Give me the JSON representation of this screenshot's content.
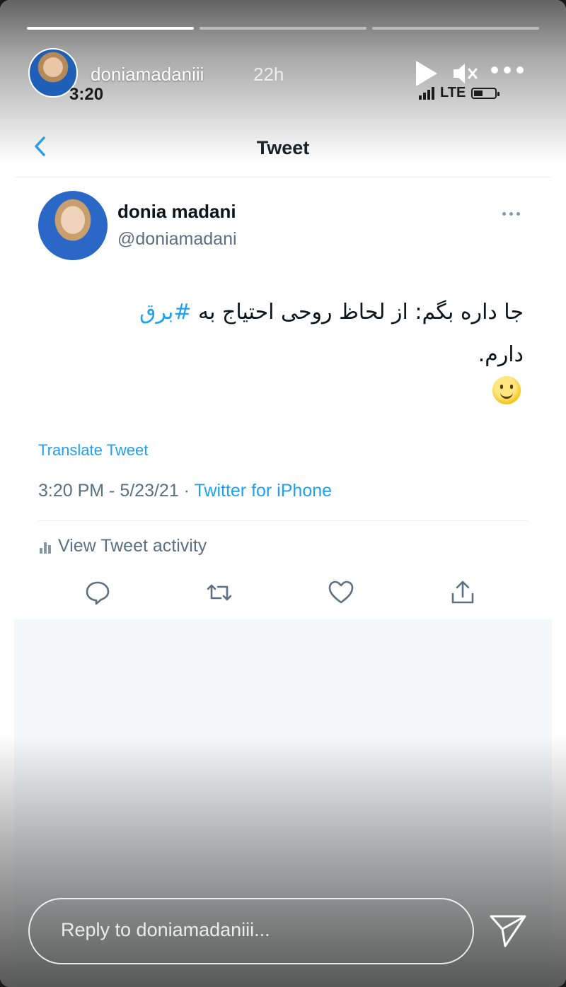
{
  "story": {
    "username": "doniamadaniii",
    "time_ago": "22h",
    "progress_segments": [
      1,
      0,
      0
    ],
    "reply_placeholder": "Reply to doniamadaniii..."
  },
  "status_bar": {
    "clock": "3:20",
    "network": "LTE"
  },
  "twitter": {
    "nav_title": "Tweet",
    "author_name": "donia madani",
    "author_handle": "@doniamadani",
    "body_line1_pre": "جا داره بگم: از لحاظ روحی احتیاج به ",
    "body_hashtag": "#برق",
    "body_line2": "دارم.",
    "translate_label": "Translate Tweet",
    "timestamp": "3:20 PM - 5/23/21 · ",
    "source": "Twitter for iPhone",
    "activity_label": "View Tweet activity"
  },
  "icons": {
    "back": "chevron-left-icon",
    "play": "play-icon",
    "mute": "mute-icon",
    "more": "more-dots-icon",
    "reply": "reply-icon",
    "retweet": "retweet-icon",
    "like": "heart-icon",
    "share": "share-icon",
    "send": "send-icon"
  },
  "colors": {
    "twitter_blue": "#1da1f2",
    "text_primary": "#0f1419",
    "text_secondary": "#5b7083"
  }
}
